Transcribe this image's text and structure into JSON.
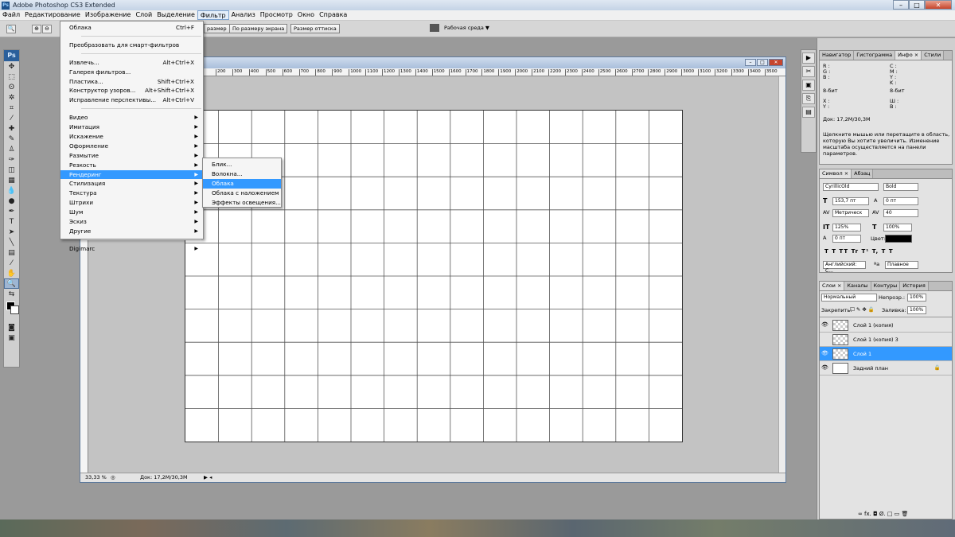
{
  "window": {
    "title": "Adobe Photoshop CS3 Extended",
    "min": "–",
    "max": "□",
    "close": "✕",
    "app_logo": "Ps"
  },
  "menubar": [
    "Файл",
    "Редактирование",
    "Изображение",
    "Слой",
    "Выделение",
    "Фильтр",
    "Анализ",
    "Просмотр",
    "Окно",
    "Справка"
  ],
  "options": {
    "fit_partial": "размер",
    "fit_screen": "По размеру экрана",
    "print_size": "Размер оттиска",
    "workspace": "Рабочая среда ▼"
  },
  "filter_menu": {
    "last_filter": "Облака",
    "last_filter_shortcut": "Ctrl+F",
    "smart": "Преобразовать для смарт-фильтров",
    "items_a": [
      {
        "label": "Извлечь...",
        "shortcut": "Alt+Ctrl+X"
      },
      {
        "label": "Галерея фильтров...",
        "shortcut": ""
      },
      {
        "label": "Пластика...",
        "shortcut": "Shift+Ctrl+X"
      },
      {
        "label": "Конструктор узоров...",
        "shortcut": "Alt+Shift+Ctrl+X"
      },
      {
        "label": "Исправление перспективы...",
        "shortcut": "Alt+Ctrl+V"
      }
    ],
    "submenus": [
      "Видео",
      "Имитация",
      "Искажение",
      "Оформление",
      "Размытие",
      "Резкость",
      "Рендеринг",
      "Стилизация",
      "Текстура",
      "Штрихи",
      "Шум",
      "Эскиз",
      "Другие"
    ],
    "digimarc": "Digimarc"
  },
  "render_submenu": [
    "Блик...",
    "Волокна...",
    "Облака",
    "Облака с наложением",
    "Эффекты освещения..."
  ],
  "ruler_labels": [
    "200",
    "300",
    "400",
    "500",
    "600",
    "700",
    "800",
    "900",
    "1000",
    "1100",
    "1200",
    "1300",
    "1400",
    "1500",
    "1600",
    "1700",
    "1800",
    "1900",
    "2000",
    "2100",
    "2200",
    "2300",
    "2400",
    "2500",
    "2600",
    "2700",
    "2800",
    "2900",
    "3000",
    "3100",
    "3200",
    "3300",
    "3400",
    "3500"
  ],
  "status": {
    "zoom": "33,33 %",
    "doc": "Док: 17,2М/30,3М"
  },
  "info_panel": {
    "tabs": [
      "Навигатор",
      "Гистограмма",
      "Инфо ×",
      "Стили"
    ],
    "rgb": "R :\nG :\nB :",
    "cmyk": "C :\nM :\nY :\nK :",
    "bits_l": "8-бит",
    "bits_r": "8-бит",
    "xy": "X :\nY :",
    "wh": "Ш :\nВ :",
    "doc": "Док: 17,2М/30,3М",
    "help": "Щелкните мышью или перетащите в область, которую Вы хотите увеличить. Изменение масштаба осуществляется на панели параметров."
  },
  "char_panel": {
    "tabs": [
      "Символ ×",
      "Абзац"
    ],
    "font": "CyrillicOld",
    "style": "Bold",
    "size": "153,7 пт",
    "leading": "0 пт",
    "kerning": "Метрическ",
    "tracking": "40",
    "vscale": "125%",
    "hscale": "100%",
    "baseline": "0 пт",
    "color_label": "Цвет:",
    "styles": "T  T   TT Tr  T¹ T,   T  T",
    "lang": "Английский: С...",
    "aa_label": "ªa",
    "aa": "Плавное"
  },
  "layers_panel": {
    "tabs": [
      "Слои ×",
      "Каналы",
      "Контуры",
      "История"
    ],
    "blend": "Нормальный",
    "opacity_label": "Непрозр.:",
    "opacity": "100%",
    "lock_label": "Закрепить:",
    "fill_label": "Заливка:",
    "fill": "100%",
    "layers": [
      {
        "name": "Слой 1 (копия)",
        "visible": true,
        "selected": false
      },
      {
        "name": "Слой 1 (копия) 3",
        "visible": false,
        "selected": false
      },
      {
        "name": "Слой 1",
        "visible": true,
        "selected": true
      },
      {
        "name": "Задний план",
        "visible": true,
        "selected": false
      }
    ],
    "footer_icons": "∞  fx.  ◘  Ø.  □  ▭  🗑"
  }
}
